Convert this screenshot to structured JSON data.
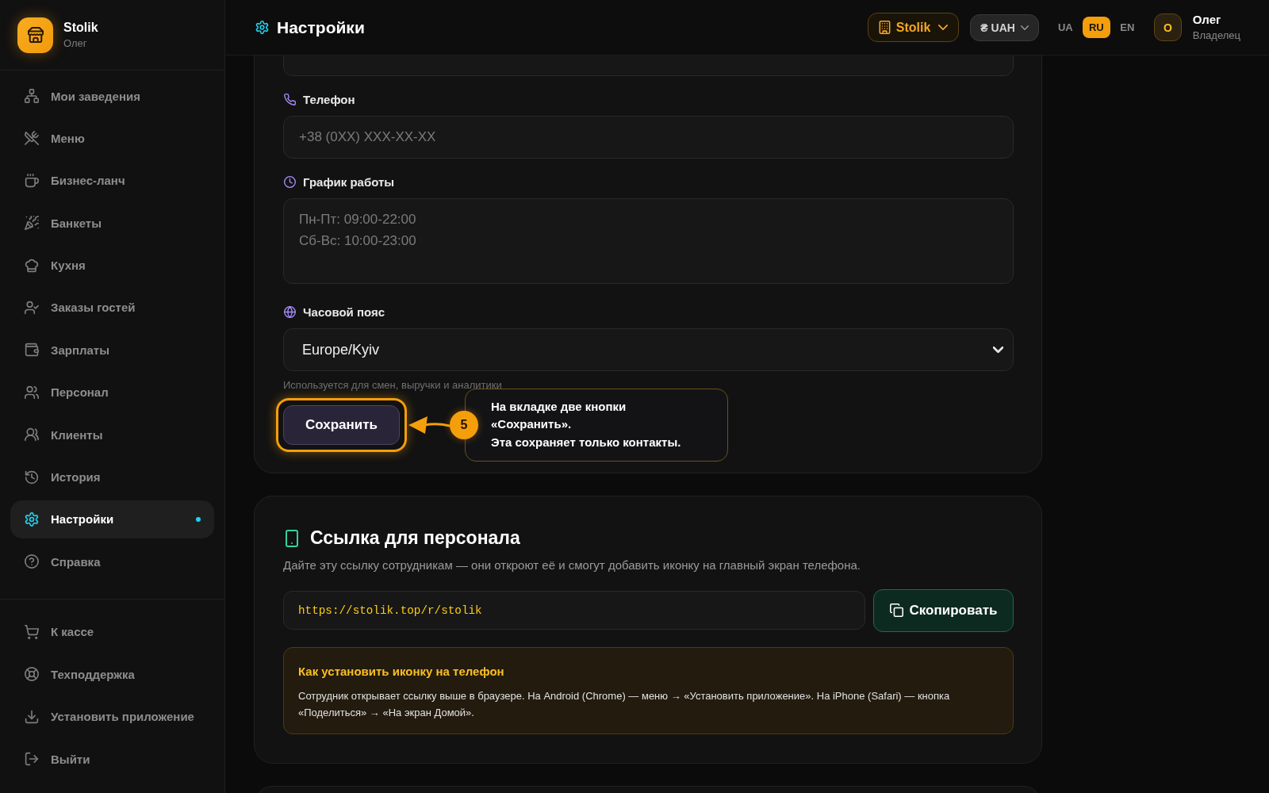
{
  "sidebar": {
    "brand": {
      "name": "Stolik",
      "user": "Олег"
    },
    "nav_items": [
      {
        "label": "Мои заведения",
        "selected": false
      },
      {
        "label": "Меню",
        "selected": false
      },
      {
        "label": "Бизнес-ланч",
        "selected": false
      },
      {
        "label": "Банкеты",
        "selected": false
      },
      {
        "label": "Кухня",
        "selected": false
      },
      {
        "label": "Заказы гостей",
        "selected": false
      },
      {
        "label": "Зарплаты",
        "selected": false
      },
      {
        "label": "Персонал",
        "selected": false
      },
      {
        "label": "Клиенты",
        "selected": false
      },
      {
        "label": "История",
        "selected": false
      },
      {
        "label": "Настройки",
        "selected": true
      },
      {
        "label": "Справка",
        "selected": false
      }
    ],
    "bottom_items": [
      {
        "label": "К кассе"
      },
      {
        "label": "Техподдержка"
      },
      {
        "label": "Установить приложение"
      },
      {
        "label": "Выйти"
      }
    ]
  },
  "top_bar": {
    "title": "Настройки",
    "venue_button": "Stolik",
    "currency_button": "₴ UAH",
    "languages": [
      {
        "label": "UA",
        "selected": false
      },
      {
        "label": "RU",
        "selected": true
      },
      {
        "label": "EN",
        "selected": false
      }
    ],
    "user": {
      "avatar_letter": "О",
      "name": "Олег",
      "role": "Владелец"
    }
  },
  "contacts_form": {
    "fields": [
      {
        "kind": "input",
        "label": "Телефон",
        "placeholder": "+38 (0XX) XXX-XX-XX"
      },
      {
        "kind": "textarea",
        "label": "График работы",
        "placeholder": "Пн-Пт: 09:00-22:00\nСб-Вс: 10:00-23:00"
      },
      {
        "kind": "select",
        "label": "Часовой пояс",
        "value": "Europe/Kyiv",
        "hint": "Используется для смен, выручки и аналитики"
      }
    ],
    "save_button": "Сохранить"
  },
  "tutorial_callout": {
    "step": "5",
    "text": "На вкладке две кнопки\n«Сохранить».\nЭта сохраняет только контакты."
  },
  "staff_link": {
    "title": "Ссылка для персонала",
    "description": "Дайте эту ссылку сотрудникам — они откроют её и смогут добавить иконку на главный экран телефона.",
    "url": "https://stolik.top/r/stolik",
    "copy_button": "Скопировать",
    "install_help": {
      "title": "Как установить иконку на телефон",
      "text": "Сотрудник открывает ссылку выше в браузере. На Android (Chrome) — меню → «Установить приложение». На iPhone (Safari) — кнопка «Поделиться» → «На экран Домой»."
    }
  }
}
